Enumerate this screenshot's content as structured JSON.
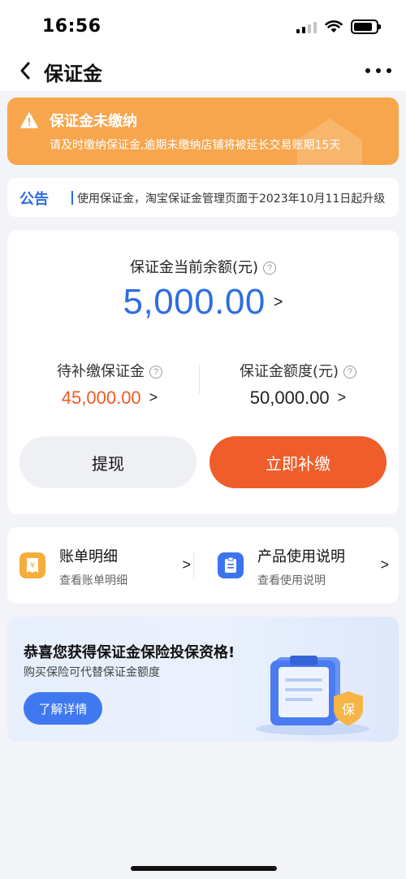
{
  "status_bar": {
    "time": "16:56"
  },
  "nav": {
    "title": "保证金"
  },
  "warning": {
    "title": "保证金未缴纳",
    "description": "请及时缴纳保证金,逾期未缴纳店铺将被延长交易账期15天",
    "color": "#f7a64d"
  },
  "notice": {
    "tag": "公告",
    "text": "使用保证金，淘宝保证金管理页面于2023年10月11日起升级"
  },
  "balance": {
    "label": "保证金当前余额(元)",
    "amount": "5,000.00",
    "pending_label": "待补缴保证金",
    "pending_amount": "45,000.00",
    "quota_label": "保证金额度(元)",
    "quota_amount": "50,000.00",
    "withdraw_button": "提现",
    "pay_button": "立即补缴",
    "accent_color": "#2f6de1",
    "pay_color": "#ef5d2a"
  },
  "links": [
    {
      "title": "账单明细",
      "subtitle": "查看账单明细",
      "icon": "bill-icon"
    },
    {
      "title": "产品使用说明",
      "subtitle": "查看使用说明",
      "icon": "document-icon"
    }
  ],
  "promo": {
    "title": "恭喜您获得保证金保险投保资格!",
    "subtitle": "购买保险可代替保证金额度",
    "button": "了解详情",
    "badge": "保"
  }
}
